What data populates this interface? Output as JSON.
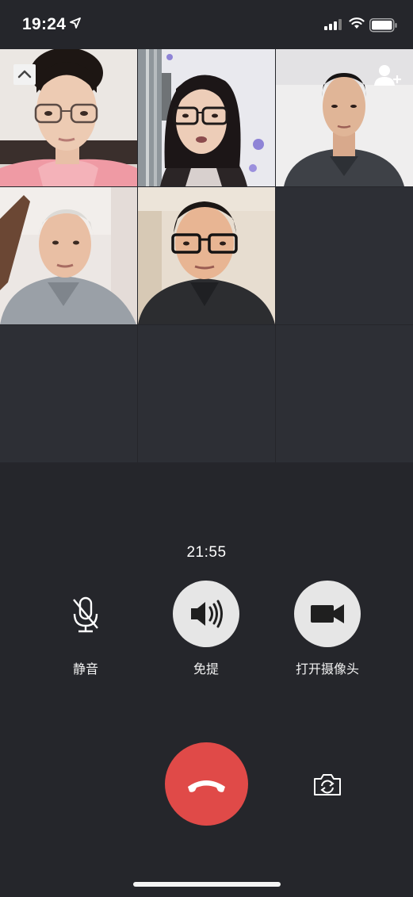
{
  "status_bar": {
    "time": "19:24",
    "icons": [
      "location-arrow-icon",
      "cellular-signal-icon",
      "wifi-icon",
      "battery-icon"
    ]
  },
  "call": {
    "duration": "21:55",
    "participants": [
      {
        "slot": 1,
        "video": "on"
      },
      {
        "slot": 2,
        "video": "on"
      },
      {
        "slot": 3,
        "video": "on"
      },
      {
        "slot": 4,
        "video": "on"
      },
      {
        "slot": 5,
        "video": "on"
      }
    ],
    "empty_slots": 4
  },
  "controls": {
    "mute_label": "静音",
    "speaker_label": "免提",
    "camera_label": "打开摄像头"
  },
  "colors": {
    "background": "#25262b",
    "hangup": "#e04a48",
    "control_circle": "#e6e6e6"
  }
}
